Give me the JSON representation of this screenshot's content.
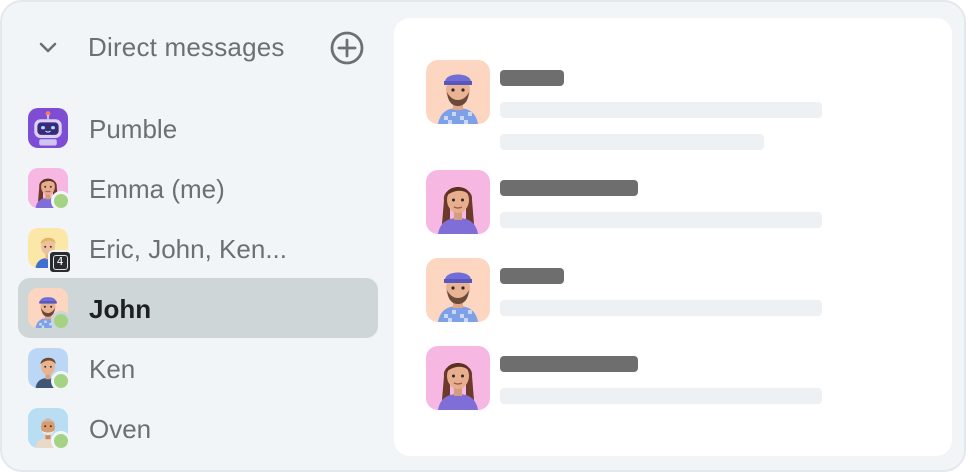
{
  "direct_messages": {
    "header_label": "Direct messages",
    "toggle_icon": "chevron-down-icon",
    "add_icon": "plus-circle-icon"
  },
  "conversations": [
    {
      "name": "Pumble",
      "avatar": "robot-avatar",
      "status": "none"
    },
    {
      "name": "Emma (me)",
      "avatar": "emma-avatar",
      "status": "online"
    },
    {
      "name": "Eric, John, Ken...",
      "avatar": "group-avatar",
      "member_count": "4"
    },
    {
      "name": "John",
      "avatar": "john-avatar",
      "status": "online",
      "selected": true
    },
    {
      "name": "Ken",
      "avatar": "ken-avatar",
      "status": "online"
    },
    {
      "name": "Oven",
      "avatar": "oven-avatar",
      "status": "online"
    }
  ],
  "colors": {
    "sidebar_bg": "#f2f5f8",
    "selected_bg": "#cfd6d8",
    "online": "#a5d383",
    "placeholder_dark": "#6e6e6e",
    "placeholder_light": "#eef1f3"
  },
  "preview_messages": [
    {
      "avatar": "john-avatar"
    },
    {
      "avatar": "emma-avatar"
    },
    {
      "avatar": "john-avatar"
    },
    {
      "avatar": "emma-avatar"
    }
  ]
}
